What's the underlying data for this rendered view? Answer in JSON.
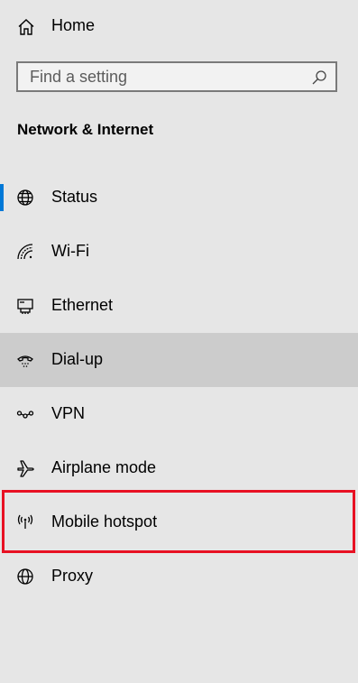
{
  "home": {
    "label": "Home",
    "icon": "home-icon"
  },
  "search": {
    "placeholder": "Find a setting",
    "value": "",
    "icon": "search-icon"
  },
  "section": {
    "title": "Network & Internet"
  },
  "nav": {
    "items": [
      {
        "label": "Status",
        "icon": "globe-icon",
        "selected": true
      },
      {
        "label": "Wi-Fi",
        "icon": "wifi-icon"
      },
      {
        "label": "Ethernet",
        "icon": "ethernet-icon"
      },
      {
        "label": "Dial-up",
        "icon": "dial-up-icon",
        "hovered": true
      },
      {
        "label": "VPN",
        "icon": "vpn-icon"
      },
      {
        "label": "Airplane mode",
        "icon": "airplane-icon"
      },
      {
        "label": "Mobile hotspot",
        "icon": "mobile-hotspot-icon",
        "highlighted": true
      },
      {
        "label": "Proxy",
        "icon": "globe-icon"
      }
    ]
  },
  "colors": {
    "background": "#e6e6e6",
    "accent": "#0078d7",
    "hover": "#cccccc",
    "highlight_border": "#e81123"
  }
}
